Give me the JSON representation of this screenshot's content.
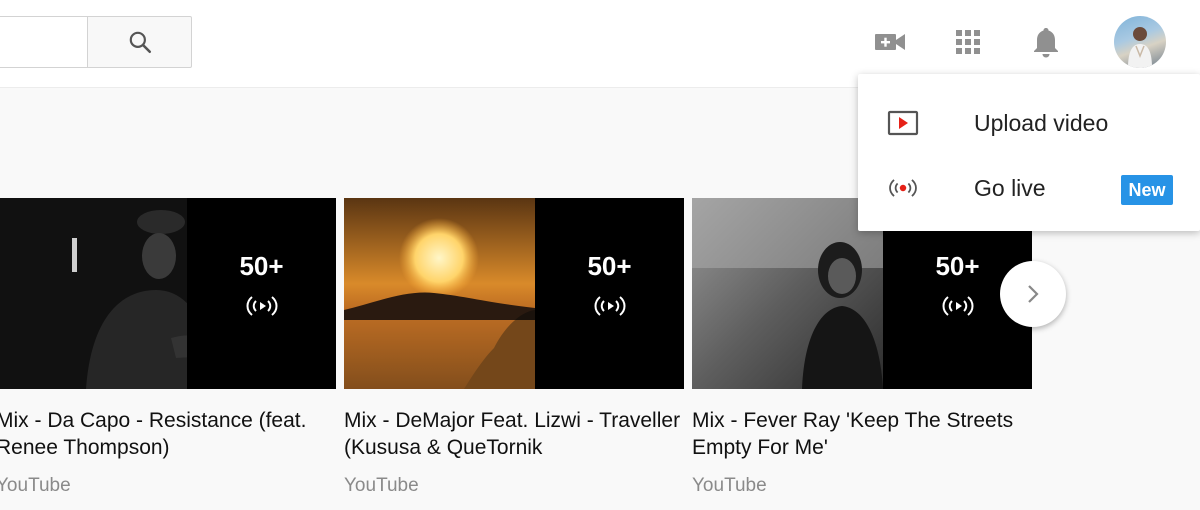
{
  "header": {
    "search_placeholder": "",
    "icons": [
      "search-icon",
      "create-video-icon",
      "apps-icon",
      "notifications-icon"
    ]
  },
  "create_menu": {
    "items": [
      {
        "label": "Upload video",
        "icon": "upload-video-icon"
      },
      {
        "label": "Go live",
        "icon": "go-live-icon",
        "badge": "New"
      }
    ]
  },
  "videos": [
    {
      "title": "Mix - Da Capo - Resistance (feat. Renee Thompson)",
      "channel": "YouTube",
      "count": "50+"
    },
    {
      "title": "Mix - DeMajor Feat. Lizwi - Traveller (Kususa & QueTornik",
      "channel": "YouTube",
      "count": "50+"
    },
    {
      "title": "Mix - Fever Ray 'Keep The Streets Empty For Me'",
      "channel": "YouTube",
      "count": "50+"
    }
  ],
  "colors": {
    "accent_red": "#e62117",
    "badge_blue": "#2793e6"
  }
}
